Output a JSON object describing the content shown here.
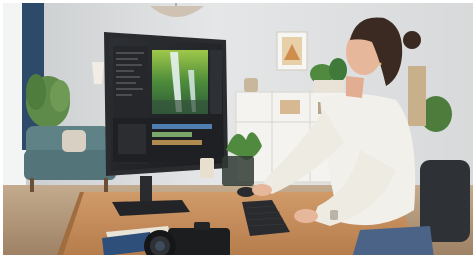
{
  "scene": {
    "description_hidden": "",
    "colors": {
      "wall": "#dfe2e4",
      "floor": "#b9a186",
      "desk": "#c78f5e",
      "monitor_frame": "#2a2b2e",
      "sweater": "#f2f0ea",
      "hair": "#3b2a22",
      "skin": "#e7b79b",
      "jeans": "#4a6387",
      "sofa": "#5e8286",
      "shelf": "#f4f3ef",
      "plant": "#3f7a3a",
      "chair": "#2e3237"
    },
    "icons": [
      "monitor-icon",
      "keyboard-icon",
      "mouse-icon",
      "camera-icon",
      "notebook-icon",
      "plant-icon",
      "lamp-icon",
      "sofa-icon",
      "shelf-icon",
      "picture-frame-icon",
      "chair-icon",
      "pendant-lamp-icon",
      "vase-icon"
    ]
  }
}
